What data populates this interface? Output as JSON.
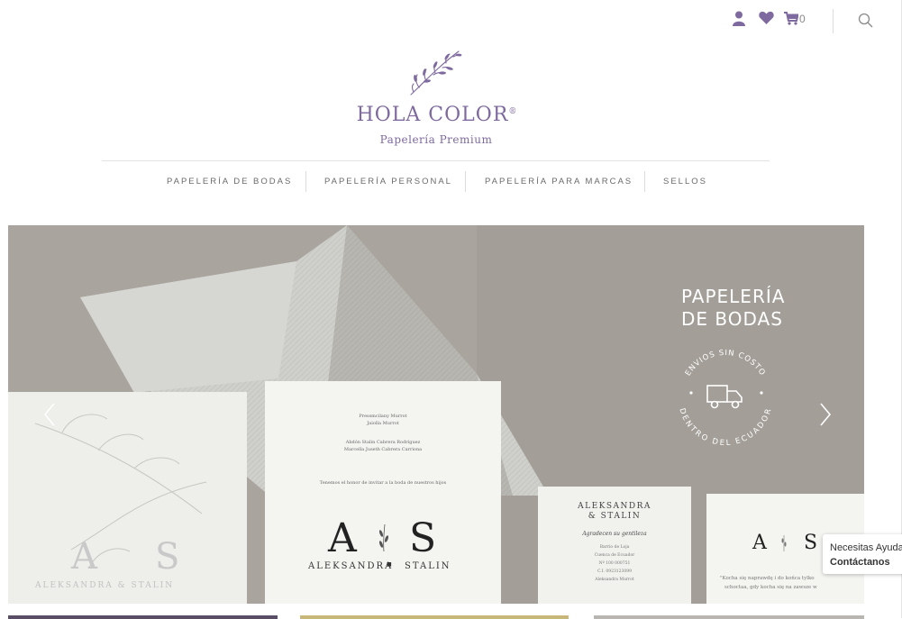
{
  "header": {
    "cart_count": "0",
    "icons": [
      "user-icon",
      "heart-icon",
      "cart-icon",
      "search-icon"
    ]
  },
  "logo": {
    "title": "HOLA COLOR",
    "registered": "®",
    "subtitle": "Papelería Premium",
    "color": "#7e6a9e"
  },
  "nav": {
    "items": [
      "PAPELERÍA DE BODAS",
      "PAPELERÍA PERSONAL",
      "PAPELERÍA PARA MARCAS",
      "SELLOS"
    ]
  },
  "hero": {
    "title_line1": "PAPELERÍA",
    "title_line2": "DE BODAS",
    "badge_top": "ENVIOS SIN COSTO",
    "badge_bottom": "DENTRO DEL ECUADOR",
    "card_main": {
      "line1": "Pressmcilany Murrot",
      "line2": "Jaiolla Murrot",
      "line3": "Abdón Stalin Cabrera Rodríguez",
      "line4": "Marcella Juseth Cabrera Carriona",
      "invite": "Tenemos el honor de invitar a la boda de nuestros hijos",
      "mono_a": "A",
      "mono_s": "S",
      "names_a": "ALEKSANDRA",
      "names_b": "STALIN"
    },
    "card_left": {
      "mono_a": "A",
      "mono_s": "S",
      "names": "ALEKSANDRA & STALIN"
    },
    "card_thanks": {
      "line1": "ALEKSANDRA",
      "line2": "& STALIN",
      "thanks": "Agradecen su gentileza",
      "d1": "Barrio de Loja",
      "d2": "Cuenca de Ecuador",
      "d3": "Nº 100 000751",
      "d4": "C.I. 0923123099",
      "d5": "Aleksandra Murrot"
    },
    "card_right": {
      "mono_a": "A",
      "mono_s": "S",
      "l1": "\"Kocha się naprawdę i do końca tylko",
      "l2": "schoctaa, gdy kocha się na zawsze w"
    },
    "colors": {
      "background": "#a7a39c",
      "envelope": "#cfcfcb",
      "card": "#f4f4f1"
    }
  },
  "chat": {
    "line1": "Necesitas Ayuda?",
    "line2": "Contáctanos"
  }
}
